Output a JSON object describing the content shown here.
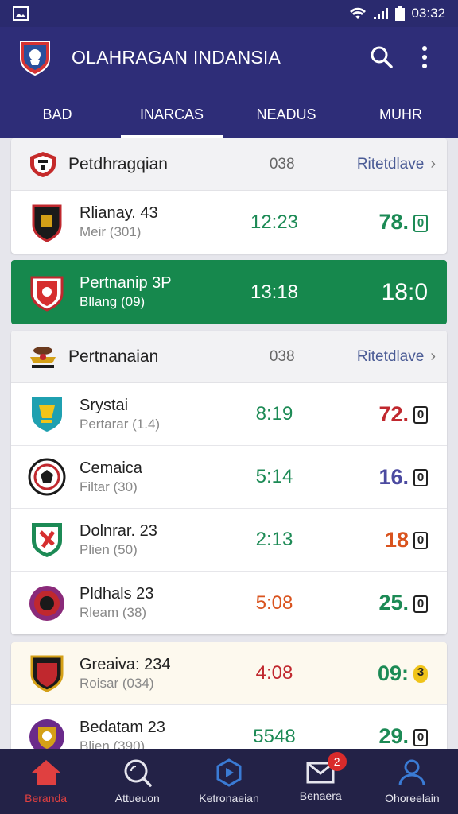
{
  "status_bar": {
    "time": "03:32"
  },
  "app": {
    "title": "OLAHRAGAN INDANSIA"
  },
  "tabs": [
    "BAD",
    "INARCAS",
    "NEADUS",
    "MUHR"
  ],
  "active_tab": 1,
  "leagues": [
    {
      "name": "Petdhragqian",
      "count": "038",
      "link_label": "Ritetdlave",
      "matches": [
        {
          "team": "Rlianay. 43",
          "detail": "Meir (301)",
          "time": "12:23",
          "score": "78.",
          "score_color": "#1c8a55"
        }
      ]
    },
    {
      "name": "Pertnanaian",
      "count": "038",
      "link_label": "Ritetdlave",
      "matches": [
        {
          "team": "Srystai",
          "detail": "Pertarar (1.4)",
          "time": "8:19",
          "score": "72.",
          "score_color": "#c0282e"
        },
        {
          "team": "Cemaica",
          "detail": "Filtar (30)",
          "time": "5:14",
          "score": "16.",
          "score_color": "#4b4aa0"
        },
        {
          "team": "Dolnrar. 23",
          "detail": "Plien (50)",
          "time": "2:13",
          "score": "18",
          "score_color": "#d9531e"
        },
        {
          "team": "Pldhals 23",
          "detail": "Rleam (38)",
          "time": "5:08",
          "score": "25.",
          "score_color": "#1c8a55"
        }
      ]
    }
  ],
  "live_match": {
    "team": "Pertnanip 3P",
    "detail": "Bllang (09)",
    "time": "13:18",
    "score": "18:0"
  },
  "highlight_matches": [
    {
      "team": "Greaiva: 234",
      "detail": "Roisar (034)",
      "time": "4:08",
      "score": "09:",
      "score_color": "#1c8a55",
      "time_color": "#c0282e"
    },
    {
      "team": "Bedatam 23",
      "detail": "Blien (390)",
      "time": "5548",
      "score": "29.",
      "score_color": "#1c8a55",
      "time_color": "#1c8a55"
    }
  ],
  "bottom_nav": [
    {
      "label": "Beranda",
      "icon": "home-icon"
    },
    {
      "label": "Attueuon",
      "icon": "search-icon"
    },
    {
      "label": "Ketronaeian",
      "icon": "video-icon"
    },
    {
      "label": "Benaera",
      "icon": "mail-icon",
      "badge": "2"
    },
    {
      "label": "Ohoreelain",
      "icon": "profile-icon"
    }
  ],
  "colors": {
    "primary": "#2e2d78",
    "live": "#16884d",
    "accent": "#e04040"
  }
}
